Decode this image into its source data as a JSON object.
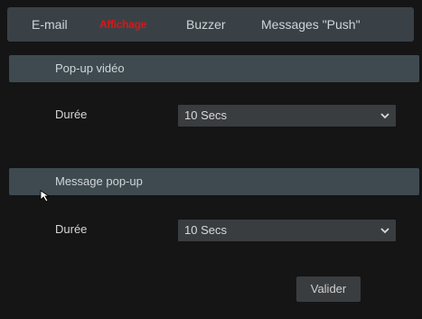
{
  "tabs": [
    {
      "label": "E-mail",
      "active": false
    },
    {
      "label": "Affichage",
      "active": true
    },
    {
      "label": "Buzzer",
      "active": false
    },
    {
      "label": "Messages \"Push\"",
      "active": false
    }
  ],
  "sections": [
    {
      "title": "Pop-up vidéo",
      "field_label": "Durée",
      "value": "10 Secs"
    },
    {
      "title": "Message pop-up",
      "field_label": "Durée",
      "value": "10 Secs"
    }
  ],
  "apply_label": "Valider",
  "icons": {
    "dropdown": "chevron-down-icon",
    "pointer": "mouse-cursor-icon"
  },
  "colors": {
    "active_tab": "#e01414",
    "tab_bar": "#3a4146",
    "section_header": "#3e4a50",
    "control": "#3a3d40",
    "background": "#151515"
  }
}
